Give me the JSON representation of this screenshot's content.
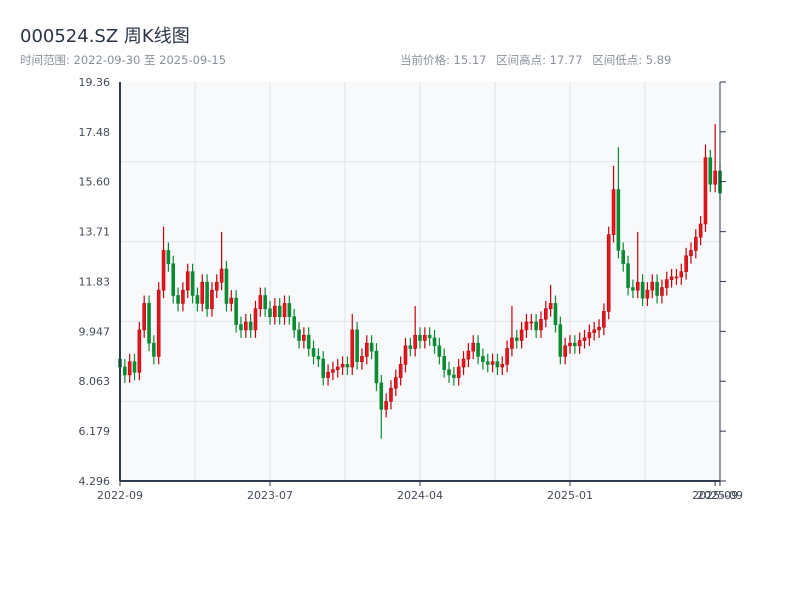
{
  "header": {
    "title": "000524.SZ 周K线图",
    "range_text": "时间范围: 2022-09-30 至 2025-09-15",
    "current_price": "当前价格: 15.17",
    "range_high": "区间高点: 17.77",
    "range_low": "区间低点: 5.89"
  },
  "colors": {
    "up": "#e0191e",
    "up_stroke": "#c4000a",
    "down": "#0b8a34",
    "plot_bg": "#f7f9fb",
    "grid": "#e2e5ea",
    "axis": "#2f3a4a"
  },
  "chart_data": {
    "type": "candlestick",
    "title": "000524.SZ 周K线图",
    "ylim": [
      4.296,
      19.36
    ],
    "yticks": [
      "4.296",
      "6.179",
      "8.063",
      "9.947",
      "11.83",
      "13.71",
      "15.60",
      "17.48",
      "19.36"
    ],
    "xticks": [
      {
        "label": "2022-09",
        "index": 0
      },
      {
        "label": "2023-07",
        "index": 31
      },
      {
        "label": "2024-04",
        "index": 62
      },
      {
        "label": "2025-01",
        "index": 93
      },
      {
        "label": "2025-09",
        "index": 123
      },
      {
        "label": "2025-09",
        "index": 124
      }
    ],
    "grid": true,
    "up_color": "red",
    "down_color": "green",
    "ohlc": [
      [
        8.9,
        9.2,
        8.3,
        8.6
      ],
      [
        8.6,
        8.9,
        8.0,
        8.3
      ],
      [
        8.3,
        9.1,
        8.0,
        8.8
      ],
      [
        8.8,
        9.1,
        8.1,
        8.4
      ],
      [
        8.4,
        10.3,
        8.1,
        10.0
      ],
      [
        10.0,
        11.3,
        9.7,
        11.0
      ],
      [
        11.0,
        11.3,
        9.2,
        9.5
      ],
      [
        9.5,
        9.8,
        8.7,
        9.0
      ],
      [
        9.0,
        11.8,
        8.7,
        11.5
      ],
      [
        11.5,
        13.9,
        11.2,
        13.0
      ],
      [
        13.0,
        13.3,
        12.2,
        12.5
      ],
      [
        12.5,
        12.8,
        11.0,
        11.3
      ],
      [
        11.3,
        11.6,
        10.7,
        11.0
      ],
      [
        11.0,
        11.8,
        10.7,
        11.5
      ],
      [
        11.5,
        12.5,
        11.2,
        12.2
      ],
      [
        12.2,
        12.5,
        11.0,
        11.3
      ],
      [
        11.3,
        11.6,
        10.7,
        11.0
      ],
      [
        11.0,
        12.1,
        10.7,
        11.8
      ],
      [
        11.8,
        12.1,
        10.5,
        10.8
      ],
      [
        10.8,
        11.8,
        10.5,
        11.5
      ],
      [
        11.5,
        12.1,
        11.2,
        11.8
      ],
      [
        11.8,
        13.7,
        11.5,
        12.3
      ],
      [
        12.3,
        12.6,
        10.7,
        11.0
      ],
      [
        11.0,
        11.5,
        10.7,
        11.2
      ],
      [
        11.2,
        11.5,
        9.9,
        10.2
      ],
      [
        10.2,
        10.5,
        9.7,
        10.0
      ],
      [
        10.0,
        10.6,
        9.7,
        10.3
      ],
      [
        10.3,
        10.6,
        9.7,
        10.0
      ],
      [
        10.0,
        11.1,
        9.7,
        10.8
      ],
      [
        10.8,
        11.6,
        10.5,
        11.3
      ],
      [
        11.3,
        11.6,
        10.5,
        10.8
      ],
      [
        10.8,
        11.1,
        10.2,
        10.5
      ],
      [
        10.5,
        11.2,
        10.2,
        10.9
      ],
      [
        10.9,
        11.2,
        10.2,
        10.5
      ],
      [
        10.5,
        11.3,
        10.2,
        11.0
      ],
      [
        11.0,
        11.3,
        10.2,
        10.5
      ],
      [
        10.5,
        10.8,
        9.7,
        10.0
      ],
      [
        10.0,
        10.3,
        9.3,
        9.6
      ],
      [
        9.6,
        10.1,
        9.3,
        9.8
      ],
      [
        9.8,
        10.1,
        9.0,
        9.3
      ],
      [
        9.3,
        9.6,
        8.7,
        9.0
      ],
      [
        9.0,
        9.3,
        8.6,
        8.9
      ],
      [
        8.9,
        9.2,
        7.9,
        8.2
      ],
      [
        8.2,
        8.7,
        7.9,
        8.4
      ],
      [
        8.4,
        8.8,
        8.1,
        8.5
      ],
      [
        8.5,
        8.9,
        8.2,
        8.6
      ],
      [
        8.6,
        9.0,
        8.3,
        8.7
      ],
      [
        8.7,
        9.0,
        8.3,
        8.6
      ],
      [
        8.6,
        10.6,
        8.3,
        10.0
      ],
      [
        10.0,
        10.3,
        8.5,
        8.8
      ],
      [
        8.8,
        9.3,
        8.5,
        9.0
      ],
      [
        9.0,
        9.8,
        8.7,
        9.5
      ],
      [
        9.5,
        9.8,
        8.9,
        9.2
      ],
      [
        9.2,
        9.5,
        7.7,
        8.0
      ],
      [
        8.0,
        8.3,
        5.89,
        7.0
      ],
      [
        7.0,
        7.6,
        6.7,
        7.3
      ],
      [
        7.3,
        8.1,
        7.0,
        7.8
      ],
      [
        7.8,
        8.5,
        7.5,
        8.2
      ],
      [
        8.2,
        9.0,
        7.9,
        8.7
      ],
      [
        8.7,
        9.7,
        8.4,
        9.4
      ],
      [
        9.4,
        9.7,
        9.0,
        9.3
      ],
      [
        9.3,
        10.9,
        9.0,
        9.8
      ],
      [
        9.8,
        10.1,
        9.3,
        9.6
      ],
      [
        9.6,
        10.1,
        9.3,
        9.8
      ],
      [
        9.8,
        10.1,
        9.4,
        9.7
      ],
      [
        9.7,
        10.0,
        9.1,
        9.4
      ],
      [
        9.4,
        9.7,
        8.7,
        9.0
      ],
      [
        9.0,
        9.3,
        8.2,
        8.5
      ],
      [
        8.5,
        8.8,
        8.0,
        8.3
      ],
      [
        8.3,
        8.6,
        7.9,
        8.2
      ],
      [
        8.2,
        8.9,
        7.9,
        8.6
      ],
      [
        8.6,
        9.2,
        8.3,
        8.9
      ],
      [
        8.9,
        9.5,
        8.6,
        9.2
      ],
      [
        9.2,
        9.8,
        8.9,
        9.5
      ],
      [
        9.5,
        9.8,
        8.7,
        9.0
      ],
      [
        9.0,
        9.3,
        8.5,
        8.8
      ],
      [
        8.8,
        9.1,
        8.4,
        8.7
      ],
      [
        8.7,
        9.1,
        8.4,
        8.8
      ],
      [
        8.8,
        9.1,
        8.3,
        8.6
      ],
      [
        8.6,
        9.0,
        8.3,
        8.7
      ],
      [
        8.7,
        9.6,
        8.4,
        9.3
      ],
      [
        9.3,
        10.9,
        9.0,
        9.7
      ],
      [
        9.7,
        10.0,
        9.3,
        9.6
      ],
      [
        9.6,
        10.3,
        9.3,
        10.0
      ],
      [
        10.0,
        10.6,
        9.7,
        10.3
      ],
      [
        10.3,
        10.6,
        10.0,
        10.3
      ],
      [
        10.3,
        10.6,
        9.7,
        10.0
      ],
      [
        10.0,
        10.7,
        9.7,
        10.4
      ],
      [
        10.4,
        11.1,
        10.1,
        10.8
      ],
      [
        10.8,
        11.7,
        10.5,
        11.0
      ],
      [
        11.0,
        11.3,
        9.9,
        10.2
      ],
      [
        10.2,
        10.5,
        8.7,
        9.0
      ],
      [
        9.0,
        9.7,
        8.7,
        9.4
      ],
      [
        9.4,
        9.8,
        9.1,
        9.5
      ],
      [
        9.5,
        9.8,
        9.1,
        9.4
      ],
      [
        9.4,
        9.9,
        9.1,
        9.6
      ],
      [
        9.6,
        10.0,
        9.3,
        9.7
      ],
      [
        9.7,
        10.2,
        9.4,
        9.9
      ],
      [
        9.9,
        10.3,
        9.6,
        10.0
      ],
      [
        10.0,
        10.4,
        9.7,
        10.1
      ],
      [
        10.1,
        11.0,
        9.8,
        10.7
      ],
      [
        10.7,
        13.9,
        10.4,
        13.6
      ],
      [
        13.6,
        16.2,
        13.3,
        15.3
      ],
      [
        15.3,
        16.9,
        12.7,
        13.0
      ],
      [
        13.0,
        13.3,
        12.2,
        12.5
      ],
      [
        12.5,
        12.8,
        11.3,
        11.6
      ],
      [
        11.6,
        11.9,
        11.2,
        11.5
      ],
      [
        11.5,
        13.7,
        11.2,
        11.8
      ],
      [
        11.8,
        12.1,
        10.9,
        11.2
      ],
      [
        11.2,
        11.8,
        10.9,
        11.5
      ],
      [
        11.5,
        12.1,
        11.2,
        11.8
      ],
      [
        11.8,
        12.1,
        11.0,
        11.3
      ],
      [
        11.3,
        11.9,
        11.0,
        11.6
      ],
      [
        11.6,
        12.2,
        11.3,
        11.9
      ],
      [
        11.9,
        12.3,
        11.6,
        12.0
      ],
      [
        12.0,
        12.3,
        11.7,
        12.0
      ],
      [
        12.0,
        12.5,
        11.7,
        12.2
      ],
      [
        12.2,
        13.1,
        11.9,
        12.8
      ],
      [
        12.8,
        13.3,
        12.5,
        13.0
      ],
      [
        13.0,
        13.8,
        12.7,
        13.5
      ],
      [
        13.5,
        14.3,
        13.2,
        14.0
      ],
      [
        14.0,
        17.0,
        13.7,
        16.5
      ],
      [
        16.5,
        16.8,
        15.2,
        15.5
      ],
      [
        15.5,
        17.77,
        15.2,
        16.0
      ],
      [
        16.0,
        16.3,
        14.9,
        15.17
      ]
    ]
  }
}
